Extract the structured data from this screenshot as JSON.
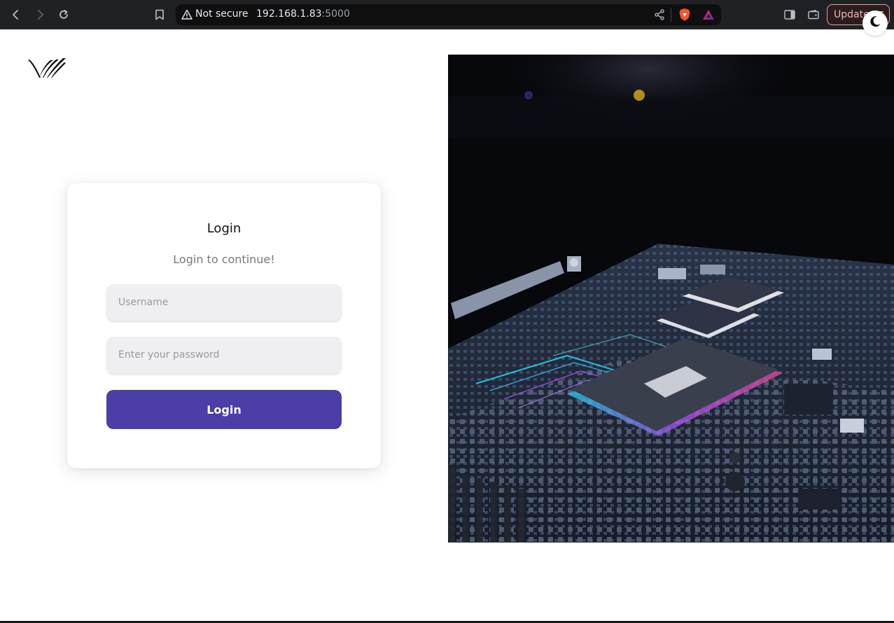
{
  "browser": {
    "security_label": "Not secure",
    "url_host": "192.168.1.83",
    "url_port": ":5000",
    "update_label": "Update"
  },
  "login": {
    "title": "Login",
    "subtitle": "Login to continue!",
    "username_placeholder": "Username",
    "password_placeholder": "Enter your password",
    "button_label": "Login"
  },
  "theme": {
    "accent": "#4b3ea6",
    "icon": "moon-icon"
  },
  "hero": {
    "image_subject": "circuit-board-chip"
  }
}
